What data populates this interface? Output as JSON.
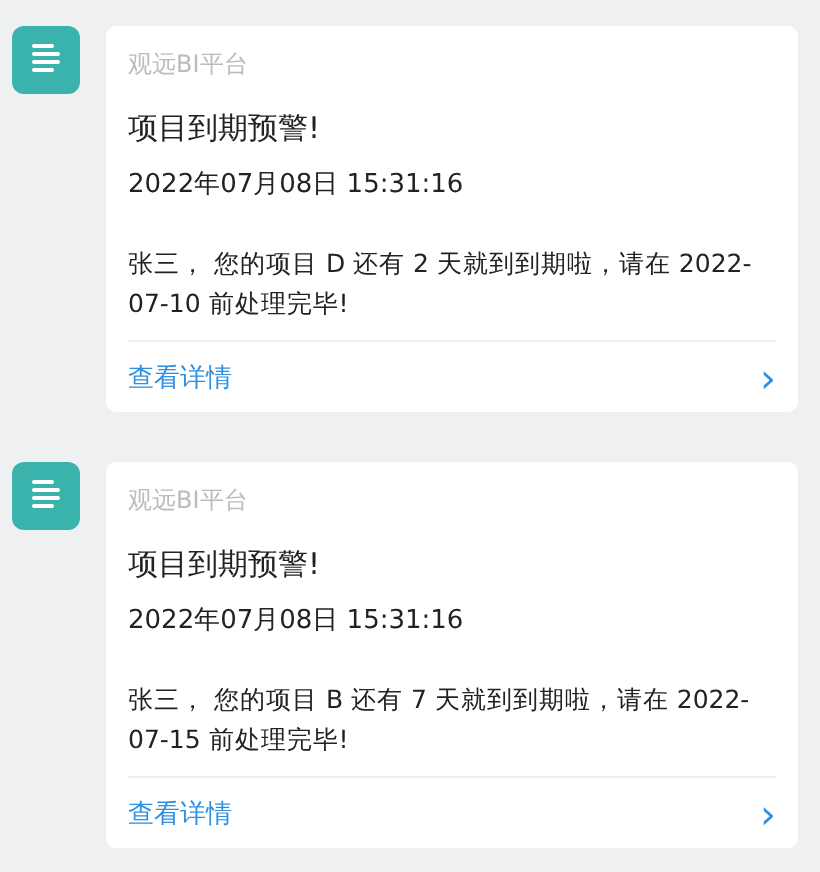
{
  "messages": [
    {
      "source": "观远BI平台",
      "title": "项目到期预警!",
      "time": "2022年07月08日 15:31:16",
      "body": "张三， 您的项目 D 还有 2 天就到到期啦，请在 2022-07-10 前处理完毕!",
      "link": "查看详情",
      "chevron": "›"
    },
    {
      "source": "观远BI平台",
      "title": "项目到期预警!",
      "time": "2022年07月08日 15:31:16",
      "body": "张三， 您的项目 B 还有 7 天就到到期啦，请在 2022-07-15 前处理完毕!",
      "link": "查看详情",
      "chevron": "›"
    }
  ]
}
